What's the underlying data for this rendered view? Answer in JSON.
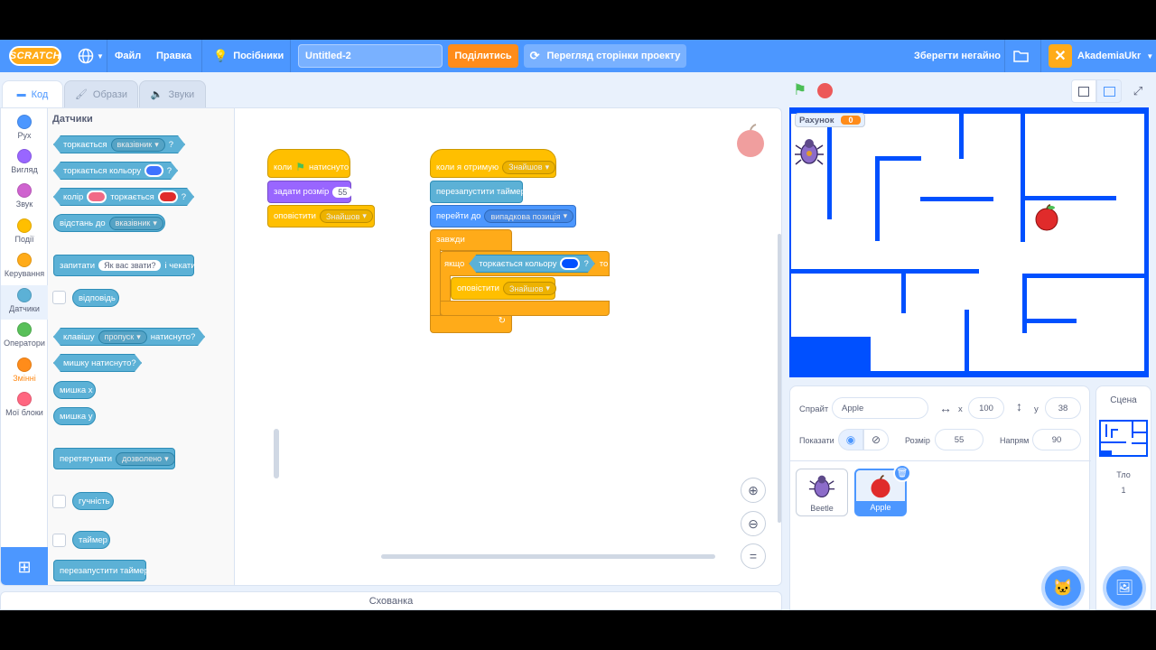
{
  "menubar": {
    "logo": "SCRATCH",
    "file": "Файл",
    "edit": "Правка",
    "tutorials": "Посібники",
    "project_title": "Untitled-2",
    "share": "Поділитись",
    "see_project_page": "Перегляд сторінки проекту",
    "save_now": "Зберегти негайно",
    "username": "AkademiaUkr"
  },
  "tabs": {
    "code": "Код",
    "costumes": "Образи",
    "sounds": "Звуки"
  },
  "categories": [
    {
      "label": "Рух",
      "color": "#4c97ff"
    },
    {
      "label": "Вигляд",
      "color": "#9966ff"
    },
    {
      "label": "Звук",
      "color": "#cf63cf"
    },
    {
      "label": "Події",
      "color": "#ffbf00"
    },
    {
      "label": "Керування",
      "color": "#ffab19"
    },
    {
      "label": "Датчики",
      "color": "#5cb1d6"
    },
    {
      "label": "Оператори",
      "color": "#59c059"
    },
    {
      "label": "Змінні",
      "color": "#ff8c1a"
    },
    {
      "label": "Мої блоки",
      "color": "#ff6680"
    }
  ],
  "palette": {
    "title": "Датчики",
    "touching": "торкається",
    "touching_target": "вказівник",
    "q": "?",
    "touching_color": "торкається кольору",
    "color_word": "колір",
    "color_touching": "торкається",
    "distance_to": "відстань до",
    "distance_target": "вказівник",
    "ask": "запитати",
    "ask_text": "Як вас звати?",
    "and_wait": "і чекати",
    "answer": "відповідь",
    "key": "клавішу",
    "key_name": "пропуск",
    "pressed": "натиснуто?",
    "mouse_down": "мишку натиснуто?",
    "mouse_x": "мишка x",
    "mouse_y": "мишка у",
    "drag_mode": "перетягувати",
    "drag_value": "дозволено",
    "loudness": "гучність",
    "timer": "таймер",
    "reset_timer": "перезапустити таймер"
  },
  "script1": {
    "when": "коли",
    "clicked": "натиснуто",
    "set_size": "задати розмір",
    "size_value": "55",
    "broadcast": "оповістити",
    "message": "Знайшов"
  },
  "script2": {
    "when_receive": "коли я отримую",
    "message": "Знайшов",
    "reset_timer": "перезапустити таймер",
    "go_to": "перейти до",
    "go_target": "випадкова позиція",
    "forever": "завжди",
    "if": "якщо",
    "touching_color": "торкається кольору",
    "q": "?",
    "then": "то",
    "broadcast": "оповістити",
    "message2": "Знайшов"
  },
  "backpack": "Схованка",
  "stage": {
    "variable_name": "Рахунок",
    "variable_value": "0"
  },
  "sprite_info": {
    "sprite_label": "Спрайт",
    "sprite_name": "Apple",
    "x_label": "x",
    "x_value": "100",
    "y_label": "y",
    "y_value": "38",
    "show_label": "Показати",
    "size_label": "Розмір",
    "size_value": "55",
    "direction_label": "Напрям",
    "direction_value": "90"
  },
  "sprites": [
    {
      "name": "Beetle",
      "selected": false
    },
    {
      "name": "Apple",
      "selected": true
    }
  ],
  "stage_panel": {
    "title": "Сцена",
    "backdrops_label": "Тло",
    "backdrops_count": "1"
  },
  "colors": {
    "accent": "#4c97ff",
    "maze": "#0050ff",
    "share": "#ff8c1a",
    "sensing": "#5cb1d6",
    "events": "#ffbf00",
    "control": "#ffab19"
  }
}
